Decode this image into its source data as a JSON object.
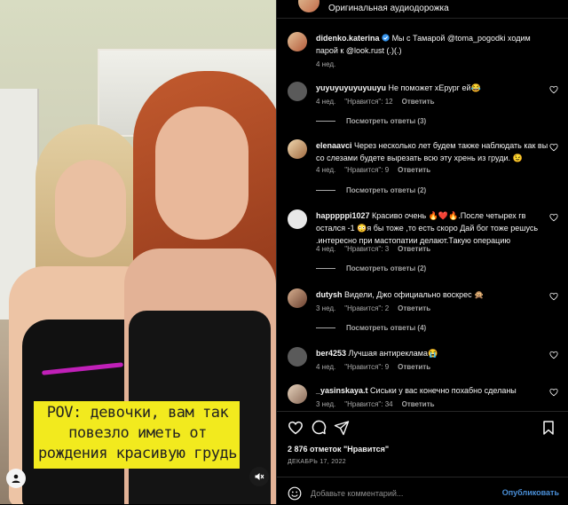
{
  "media": {
    "caption": "POV: девочки, вам так повезло иметь от рождения красивую грудь",
    "accent_yellow": "#f2ea1e",
    "accent_pink": "#c020b8"
  },
  "audio": {
    "label": "Оригинальная аудиодорожка"
  },
  "post": {
    "username": "didenko.katerina",
    "text": " Мы с Тамарой @toma_pogodki ходим парой к @look.rust (.)(.)",
    "time": "4 нед."
  },
  "comments": [
    {
      "username": "yuyuyuyuyuyuuyu",
      "text": " Не поможет хЕрург ей😂",
      "time": "4 нед.",
      "likes": "\"Нравится\": 12",
      "reply": "Ответить",
      "view_replies": "Посмотреть ответы (3)"
    },
    {
      "username": "elenaavci",
      "text": " Через несколько лет будем также наблюдать как вы со слезами будете вырезать всю эту хрень из груди. 😉",
      "time": "4 нед.",
      "likes": "\"Нравится\": 9",
      "reply": "Ответить",
      "view_replies": "Посмотреть ответы (2)"
    },
    {
      "username": "happpppi1027",
      "text": " Красиво очень 🔥❤️🔥.После четырех гв остался -1 😳я бы тоже ,то есть скоро Дай бог тоже решусь .интересно при мастопатии делают.Такую операцию",
      "time": "4 нед.",
      "likes": "\"Нравится\": 3",
      "reply": "Ответить",
      "view_replies": "Посмотреть ответы (2)"
    },
    {
      "username": "dutysh",
      "text": " Видели, Джо официально воскрес 🙊",
      "time": "3 нед.",
      "likes": "\"Нравится\": 2",
      "reply": "Ответить",
      "view_replies": "Посмотреть ответы (4)"
    },
    {
      "username": "ber4253",
      "text": " Лучшая антиреклама😭",
      "time": "4 нед.",
      "likes": "\"Нравится\": 9",
      "reply": "Ответить",
      "view_replies": ""
    },
    {
      "username": "_yasinskaya.t",
      "text": " Сиськи у вас конечно похабно сделаны",
      "time": "3 нед.",
      "likes": "\"Нравится\": 34",
      "reply": "Ответить",
      "view_replies": ""
    }
  ],
  "footer": {
    "likes_count": "2 876 отметок \"Нравится\"",
    "date": "ДЕКАБРЬ 17, 2022",
    "comment_placeholder": "Добавьте комментарий...",
    "publish_label": "Опубликовать",
    "publish_color": "#4a8fd8"
  }
}
